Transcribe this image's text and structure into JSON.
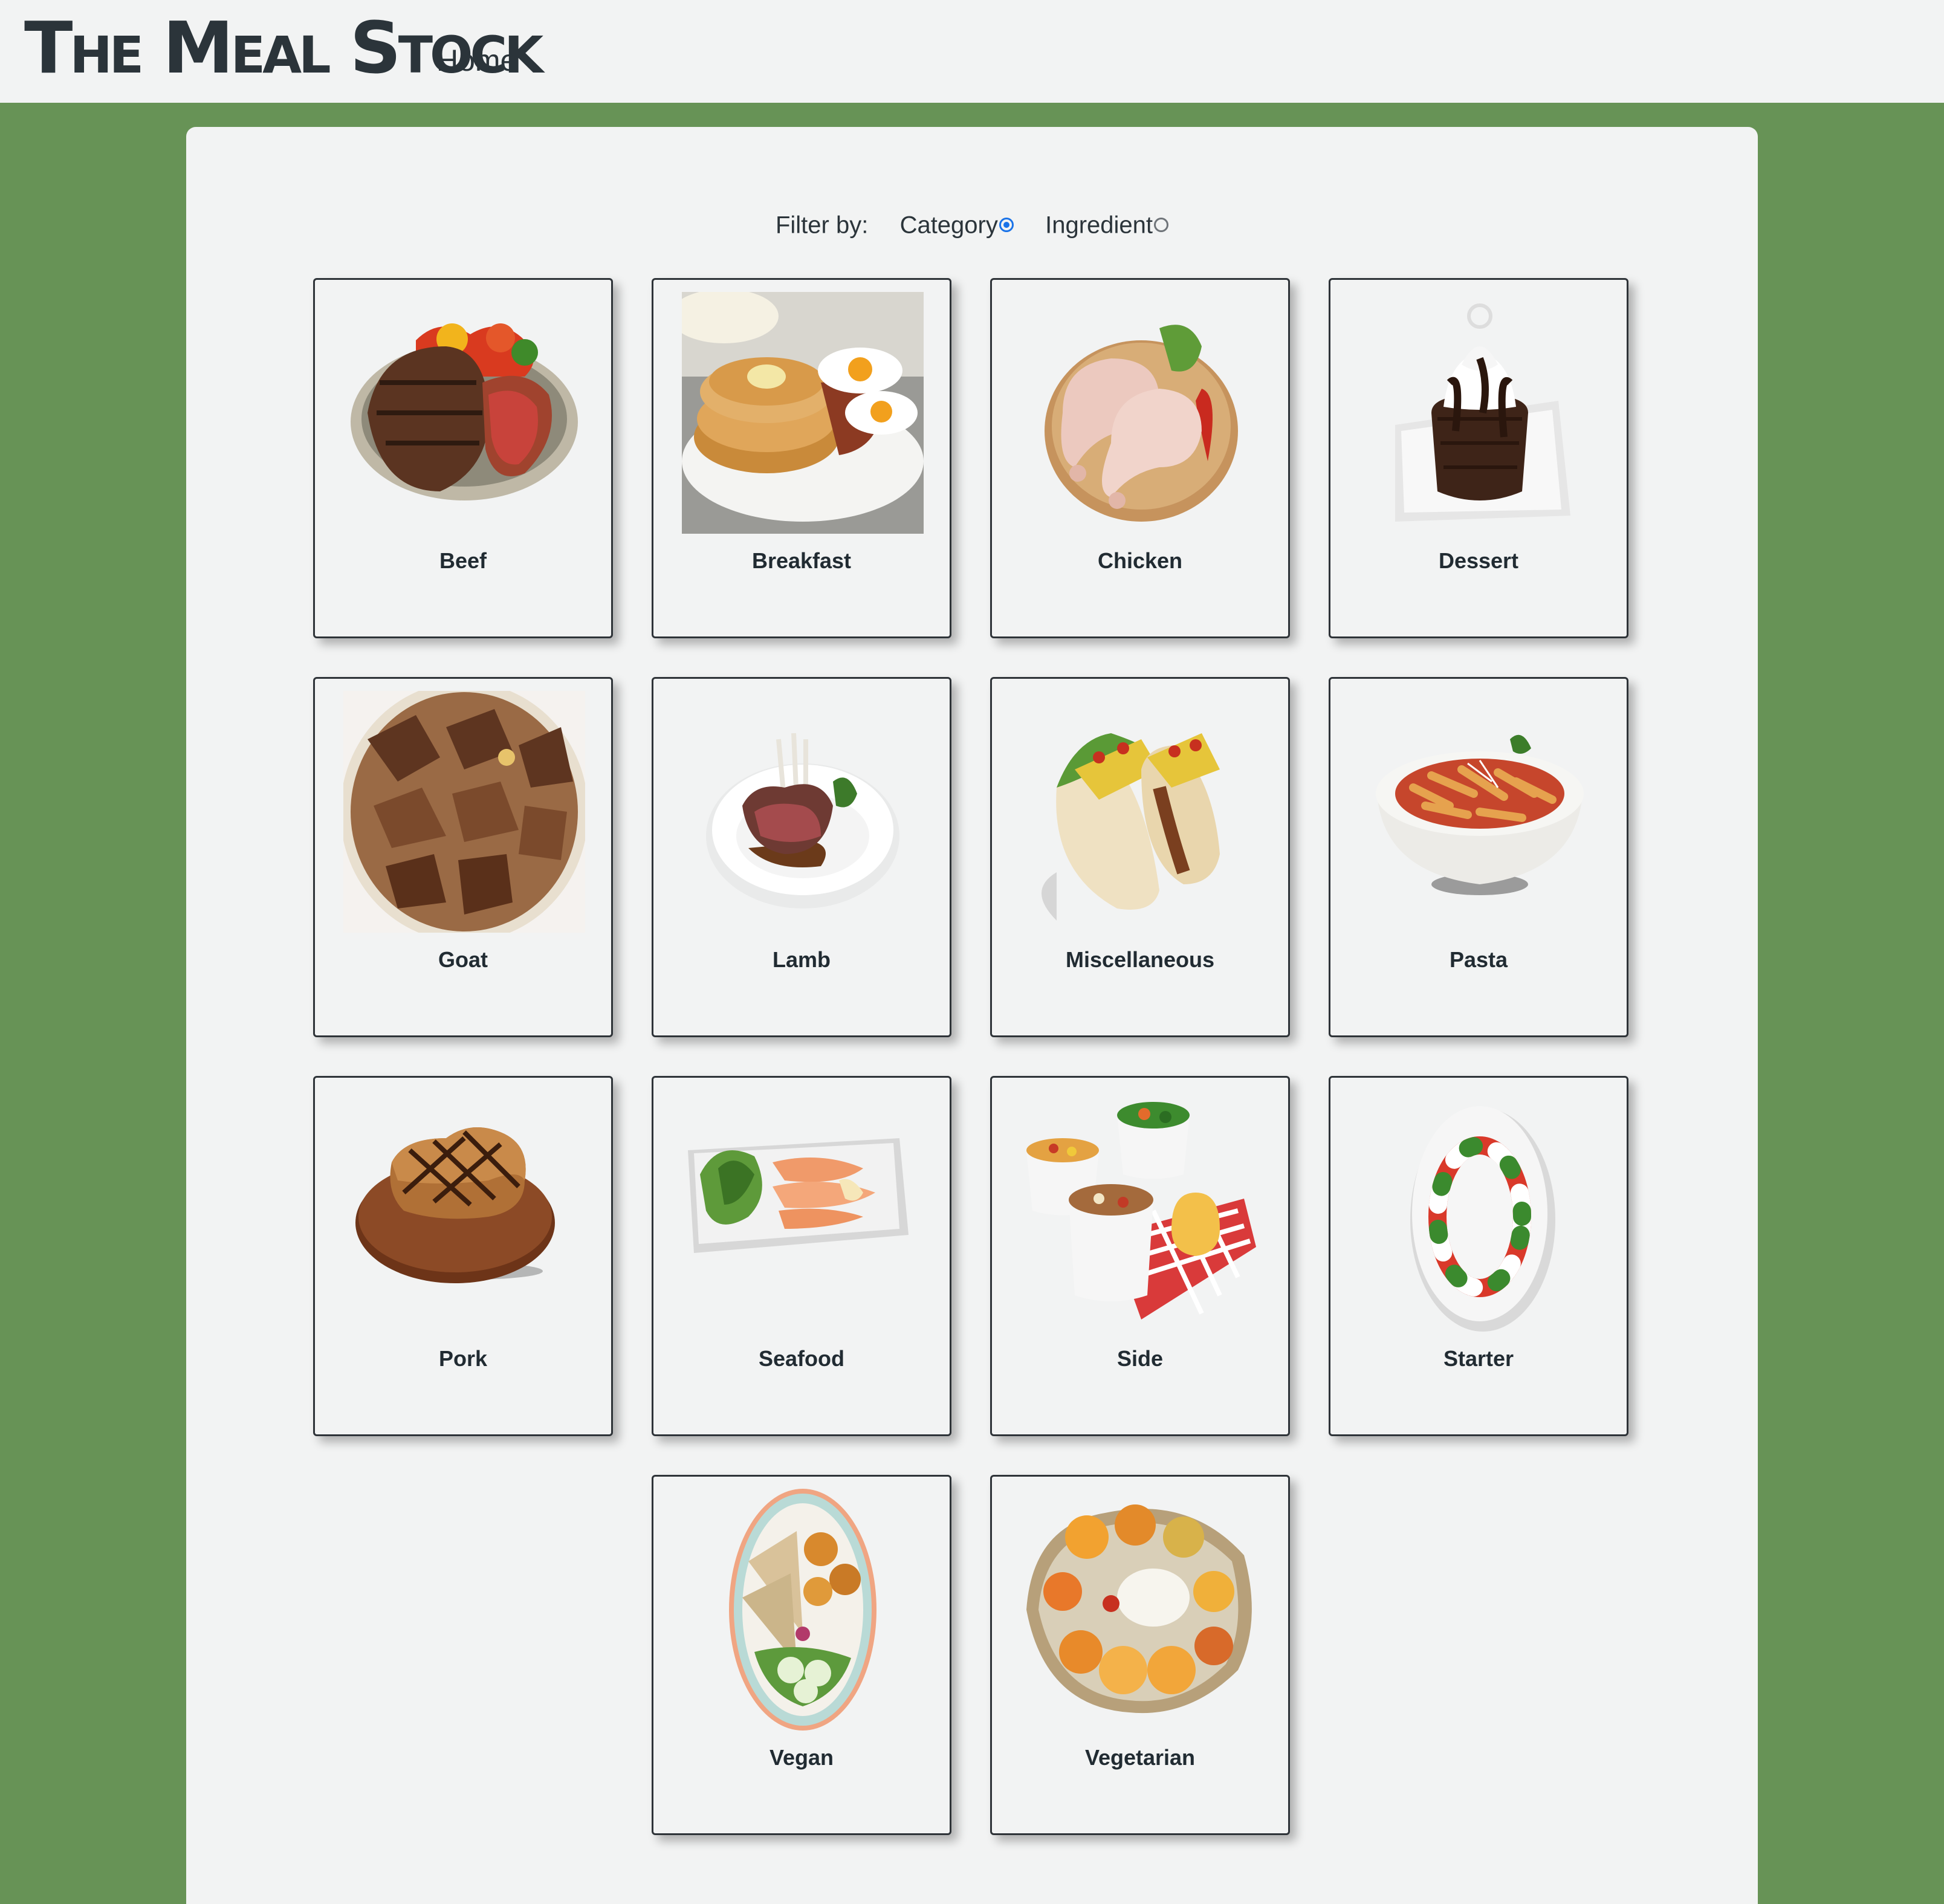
{
  "navbar": {
    "brand": "The Meal Stock",
    "home_link": "Home"
  },
  "filter": {
    "label": "Filter by:",
    "options": [
      {
        "label": "Category",
        "checked": true
      },
      {
        "label": "Ingredient",
        "checked": false
      }
    ]
  },
  "categories": [
    {
      "name": "Beef",
      "image": "beef-steak-plate"
    },
    {
      "name": "Breakfast",
      "image": "pancakes-eggs-bacon"
    },
    {
      "name": "Chicken",
      "image": "raw-chicken-legs-board"
    },
    {
      "name": "Dessert",
      "image": "chocolate-cake-cream"
    },
    {
      "name": "Goat",
      "image": "roasted-goat-bowl"
    },
    {
      "name": "Lamb",
      "image": "lamb-chops-plate"
    },
    {
      "name": "Miscellaneous",
      "image": "tacos"
    },
    {
      "name": "Pasta",
      "image": "penne-pasta-bowl"
    },
    {
      "name": "Pork",
      "image": "pork-chop-board"
    },
    {
      "name": "Seafood",
      "image": "smoked-salmon-salad"
    },
    {
      "name": "Side",
      "image": "side-dish-ramekins"
    },
    {
      "name": "Starter",
      "image": "caprese-plate"
    },
    {
      "name": "Vegan",
      "image": "vegan-bowl"
    },
    {
      "name": "Vegetarian",
      "image": "vegetarian-thali"
    }
  ],
  "colors": {
    "page_background": "#679356",
    "panel_background": "#f2f3f3",
    "text": "#212b32",
    "radio_accent": "#1a73e8"
  }
}
